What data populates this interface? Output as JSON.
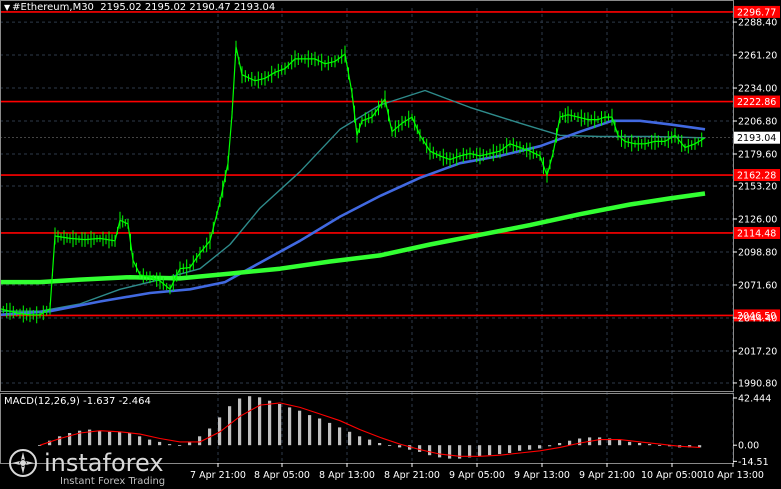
{
  "header": {
    "symbol": "#Ethereum,M30",
    "ohlc": "2195.02 2195.02 2190.47 2193.04"
  },
  "macd": {
    "label": "MACD(12,26,9)",
    "main": "-1.637",
    "signal": "-2.464"
  },
  "brand": {
    "name": "instaforex",
    "tagline": "Instant Forex Trading"
  },
  "colors": {
    "background": "#000000",
    "grid": "#2e3a4a",
    "candles": "#00ff00",
    "level_line": "#ff0000",
    "ma_fast": "#2e8b8b",
    "ma_mid": "#4169e1",
    "ma_slow": "#32ff32",
    "macd_hist": "#c0c0c0",
    "macd_signal": "#ff0000",
    "current_price_bg": "#ffffff"
  },
  "chart_data": {
    "type": "candlestick",
    "yaxis": {
      "range": [
        1985,
        2300
      ],
      "ticks": [
        2288.4,
        2261.2,
        2234.0,
        2206.8,
        2179.6,
        2153.2,
        2126.0,
        2098.8,
        2071.6,
        2044.4,
        2017.2,
        1990.8
      ]
    },
    "xaxis": {
      "ticks": [
        "7 Apr 21:00",
        "8 Apr 05:00",
        "8 Apr 13:00",
        "8 Apr 21:00",
        "9 Apr 05:00",
        "9 Apr 13:00",
        "9 Apr 21:00",
        "10 Apr 05:00",
        "10 Apr 13:00"
      ]
    },
    "current_price": 2193.04,
    "levels": [
      2296.77,
      2222.86,
      2162.28,
      2114.48,
      2046.5
    ],
    "price": [
      [
        0,
        2052
      ],
      [
        10,
        2050
      ],
      [
        20,
        2048
      ],
      [
        30,
        2047
      ],
      [
        40,
        2047
      ],
      [
        50,
        2052
      ],
      [
        55,
        2112
      ],
      [
        70,
        2110
      ],
      [
        85,
        2109
      ],
      [
        100,
        2110
      ],
      [
        115,
        2108
      ],
      [
        120,
        2125
      ],
      [
        128,
        2122
      ],
      [
        133,
        2092
      ],
      [
        140,
        2080
      ],
      [
        150,
        2078
      ],
      [
        160,
        2075
      ],
      [
        170,
        2068
      ],
      [
        180,
        2085
      ],
      [
        190,
        2086
      ],
      [
        200,
        2098
      ],
      [
        210,
        2108
      ],
      [
        220,
        2140
      ],
      [
        228,
        2172
      ],
      [
        232,
        2212
      ],
      [
        236,
        2268
      ],
      [
        242,
        2245
      ],
      [
        255,
        2240
      ],
      [
        265,
        2242
      ],
      [
        275,
        2247
      ],
      [
        285,
        2250
      ],
      [
        295,
        2258
      ],
      [
        305,
        2258
      ],
      [
        315,
        2258
      ],
      [
        325,
        2254
      ],
      [
        335,
        2256
      ],
      [
        345,
        2262
      ],
      [
        352,
        2230
      ],
      [
        357,
        2195
      ],
      [
        362,
        2207
      ],
      [
        372,
        2210
      ],
      [
        385,
        2225
      ],
      [
        392,
        2198
      ],
      [
        402,
        2205
      ],
      [
        412,
        2210
      ],
      [
        420,
        2195
      ],
      [
        430,
        2182
      ],
      [
        440,
        2178
      ],
      [
        450,
        2175
      ],
      [
        460,
        2178
      ],
      [
        470,
        2180
      ],
      [
        480,
        2178
      ],
      [
        490,
        2180
      ],
      [
        500,
        2182
      ],
      [
        510,
        2188
      ],
      [
        520,
        2185
      ],
      [
        530,
        2182
      ],
      [
        540,
        2178
      ],
      [
        547,
        2162
      ],
      [
        553,
        2180
      ],
      [
        560,
        2210
      ],
      [
        568,
        2212
      ],
      [
        578,
        2210
      ],
      [
        588,
        2208
      ],
      [
        598,
        2208
      ],
      [
        605,
        2210
      ],
      [
        612,
        2210
      ],
      [
        618,
        2195
      ],
      [
        625,
        2190
      ],
      [
        635,
        2188
      ],
      [
        645,
        2188
      ],
      [
        655,
        2190
      ],
      [
        665,
        2190
      ],
      [
        675,
        2195
      ],
      [
        685,
        2185
      ],
      [
        695,
        2188
      ],
      [
        705,
        2193
      ]
    ],
    "series": [
      {
        "values": [
          [
            0,
            2050
          ],
          [
            40,
            2050
          ],
          [
            80,
            2056
          ],
          [
            120,
            2068
          ],
          [
            160,
            2076
          ],
          [
            200,
            2085
          ],
          [
            230,
            2105
          ],
          [
            260,
            2135
          ],
          [
            300,
            2165
          ],
          [
            340,
            2200
          ],
          [
            380,
            2220
          ],
          [
            425,
            2232
          ],
          [
            470,
            2218
          ],
          [
            520,
            2205
          ],
          [
            560,
            2195
          ],
          [
            600,
            2194
          ],
          [
            650,
            2194
          ],
          [
            705,
            2193
          ]
        ]
      },
      {
        "values": [
          [
            0,
            2047
          ],
          [
            50,
            2050
          ],
          [
            100,
            2058
          ],
          [
            150,
            2065
          ],
          [
            190,
            2068
          ],
          [
            225,
            2074
          ],
          [
            260,
            2090
          ],
          [
            300,
            2108
          ],
          [
            340,
            2128
          ],
          [
            380,
            2145
          ],
          [
            420,
            2160
          ],
          [
            460,
            2172
          ],
          [
            500,
            2178
          ],
          [
            540,
            2186
          ],
          [
            580,
            2198
          ],
          [
            612,
            2207
          ],
          [
            640,
            2207
          ],
          [
            670,
            2204
          ],
          [
            705,
            2200
          ]
        ]
      },
      {
        "values": [
          [
            0,
            2074
          ],
          [
            40,
            2074
          ],
          [
            80,
            2076
          ],
          [
            130,
            2078
          ],
          [
            180,
            2077
          ],
          [
            230,
            2081
          ],
          [
            280,
            2085
          ],
          [
            330,
            2091
          ],
          [
            380,
            2096
          ],
          [
            430,
            2105
          ],
          [
            480,
            2113
          ],
          [
            530,
            2121
          ],
          [
            580,
            2130
          ],
          [
            630,
            2138
          ],
          [
            670,
            2143
          ],
          [
            705,
            2147
          ]
        ]
      }
    ],
    "macd_panel": {
      "ticks": [
        42.444,
        0.0,
        -14.51
      ],
      "range": [
        -16,
        46
      ],
      "histogram": [
        [
          40,
          0
        ],
        [
          50,
          4
        ],
        [
          60,
          8
        ],
        [
          70,
          11
        ],
        [
          80,
          13
        ],
        [
          90,
          14
        ],
        [
          100,
          13
        ],
        [
          110,
          12
        ],
        [
          120,
          12
        ],
        [
          130,
          11
        ],
        [
          140,
          8
        ],
        [
          150,
          5
        ],
        [
          160,
          3
        ],
        [
          170,
          1
        ],
        [
          180,
          0
        ],
        [
          190,
          3
        ],
        [
          200,
          8
        ],
        [
          210,
          15
        ],
        [
          220,
          25
        ],
        [
          230,
          35
        ],
        [
          240,
          42
        ],
        [
          250,
          44
        ],
        [
          260,
          43
        ],
        [
          270,
          40
        ],
        [
          280,
          37
        ],
        [
          290,
          34
        ],
        [
          300,
          31
        ],
        [
          310,
          27
        ],
        [
          320,
          24
        ],
        [
          330,
          20
        ],
        [
          340,
          16
        ],
        [
          350,
          12
        ],
        [
          360,
          8
        ],
        [
          370,
          5
        ],
        [
          380,
          2
        ],
        [
          390,
          0
        ],
        [
          400,
          -2
        ],
        [
          410,
          -4
        ],
        [
          420,
          -6
        ],
        [
          430,
          -9
        ],
        [
          440,
          -11
        ],
        [
          450,
          -12
        ],
        [
          460,
          -12
        ],
        [
          470,
          -11
        ],
        [
          480,
          -10
        ],
        [
          490,
          -9
        ],
        [
          500,
          -8
        ],
        [
          510,
          -7
        ],
        [
          520,
          -5
        ],
        [
          530,
          -4
        ],
        [
          540,
          -3
        ],
        [
          550,
          -1
        ],
        [
          560,
          2
        ],
        [
          570,
          4
        ],
        [
          580,
          6
        ],
        [
          590,
          7
        ],
        [
          600,
          7
        ],
        [
          610,
          6
        ],
        [
          620,
          5
        ],
        [
          630,
          3
        ],
        [
          640,
          2
        ],
        [
          650,
          1
        ],
        [
          660,
          0
        ],
        [
          670,
          -1
        ],
        [
          680,
          -2
        ],
        [
          690,
          -2
        ],
        [
          700,
          -2
        ]
      ],
      "signal": [
        [
          40,
          0
        ],
        [
          60,
          6
        ],
        [
          80,
          11
        ],
        [
          100,
          13
        ],
        [
          120,
          12
        ],
        [
          140,
          10
        ],
        [
          160,
          6
        ],
        [
          180,
          3
        ],
        [
          200,
          3
        ],
        [
          220,
          12
        ],
        [
          240,
          26
        ],
        [
          260,
          36
        ],
        [
          280,
          38
        ],
        [
          300,
          34
        ],
        [
          320,
          28
        ],
        [
          340,
          22
        ],
        [
          360,
          14
        ],
        [
          380,
          7
        ],
        [
          400,
          1
        ],
        [
          420,
          -4
        ],
        [
          440,
          -8
        ],
        [
          460,
          -10
        ],
        [
          480,
          -10
        ],
        [
          500,
          -9
        ],
        [
          520,
          -7
        ],
        [
          540,
          -5
        ],
        [
          560,
          -2
        ],
        [
          580,
          2
        ],
        [
          600,
          5
        ],
        [
          620,
          5
        ],
        [
          640,
          3
        ],
        [
          660,
          1
        ],
        [
          680,
          -1
        ],
        [
          700,
          -2
        ]
      ]
    }
  }
}
